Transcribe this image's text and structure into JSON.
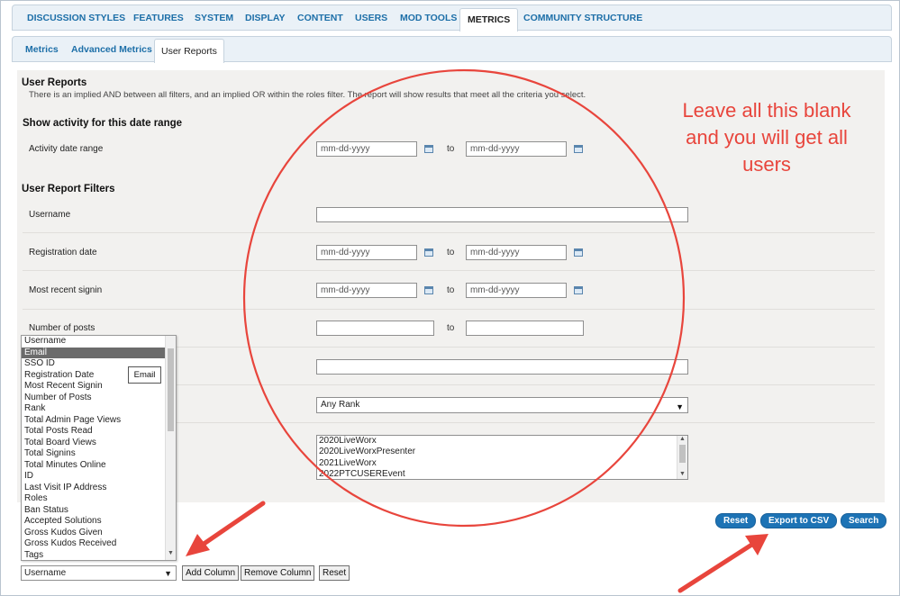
{
  "nav": {
    "tabs": [
      {
        "label": "DISCUSSION STYLES"
      },
      {
        "label": "FEATURES"
      },
      {
        "label": "SYSTEM"
      },
      {
        "label": "DISPLAY"
      },
      {
        "label": "CONTENT"
      },
      {
        "label": "USERS"
      },
      {
        "label": "MOD TOOLS"
      },
      {
        "label": "METRICS",
        "active": true
      },
      {
        "label": "COMMUNITY STRUCTURE"
      }
    ]
  },
  "subnav": {
    "tabs": [
      {
        "label": "Metrics"
      },
      {
        "label": "Advanced Metrics"
      },
      {
        "label": "User Reports",
        "active": true
      }
    ]
  },
  "report": {
    "title": "User Reports",
    "description": "There is an implied AND between all filters, and an implied OR within the roles filter. The report will show results that meet all the criteria you select.",
    "date_section_title": "Show activity for this date range",
    "activity_label": "Activity date range",
    "date_placeholder": "mm-dd-yyyy",
    "to_label": "to",
    "filters_title": "User Report Filters",
    "username_label": "Username",
    "registration_label": "Registration date",
    "signin_label": "Most recent signin",
    "posts_label": "Number of posts",
    "rank_value": "Any Rank",
    "roles": [
      "2020LiveWorx",
      "2020LiveWorxPresenter",
      "2021LiveWorx",
      "2022PTCUSEREvent"
    ]
  },
  "actions": {
    "reset": "Reset",
    "export": "Export to CSV",
    "search": "Search"
  },
  "columns": {
    "options": [
      "Username",
      "Email",
      "SSO ID",
      "Registration Date",
      "Most Recent Signin",
      "Number of Posts",
      "Rank",
      "Total Admin Page Views",
      "Total Posts Read",
      "Total Board Views",
      "Total Signins",
      "Total Minutes Online",
      "ID",
      "Last Visit IP Address",
      "Roles",
      "Ban Status",
      "Accepted Solutions",
      "Gross Kudos Given",
      "Gross Kudos Received",
      "Tags"
    ],
    "highlighted": "Email",
    "tooltip": "Email",
    "selected": "Username",
    "add_button": "Add Column",
    "remove_button": "Remove Column",
    "reset_button": "Reset"
  },
  "annotation": {
    "line1": "Leave all this blank",
    "line2": "and you will get all",
    "line3": "users",
    "color": "#e8453c"
  }
}
